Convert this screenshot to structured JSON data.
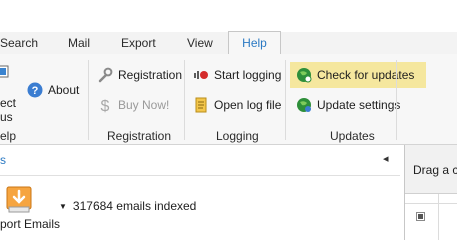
{
  "tabs": [
    {
      "label": "Search",
      "active": false
    },
    {
      "label": "Mail",
      "active": false
    },
    {
      "label": "Export",
      "active": false
    },
    {
      "label": "View",
      "active": false
    },
    {
      "label": "Help",
      "active": true
    }
  ],
  "ribbon": {
    "help_group": {
      "partial_button_line1": "ect",
      "partial_button_line2": "us",
      "about_label": "About",
      "group_label_partial": "elp"
    },
    "registration_group": {
      "registration_label": "Registration",
      "buy_now_label": "Buy Now!",
      "group_label": "Registration"
    },
    "logging_group": {
      "start_logging_label": "Start logging",
      "open_log_label": "Open log file",
      "group_label": "Logging"
    },
    "updates_group": {
      "check_updates_label": "Check for updates",
      "update_settings_label": "Update settings",
      "group_label": "Updates"
    }
  },
  "pane": {
    "left_marker": "s",
    "collapse_arrow": "◂"
  },
  "right_panel": {
    "drag_text": "Drag a co"
  },
  "content": {
    "export_emails_label": "port Emails",
    "indexed_text": "317684 emails indexed"
  },
  "colors": {
    "accent": "#2a79c3",
    "highlight": "#f5e79e",
    "ribbon_bg": "#f7f7f7"
  }
}
